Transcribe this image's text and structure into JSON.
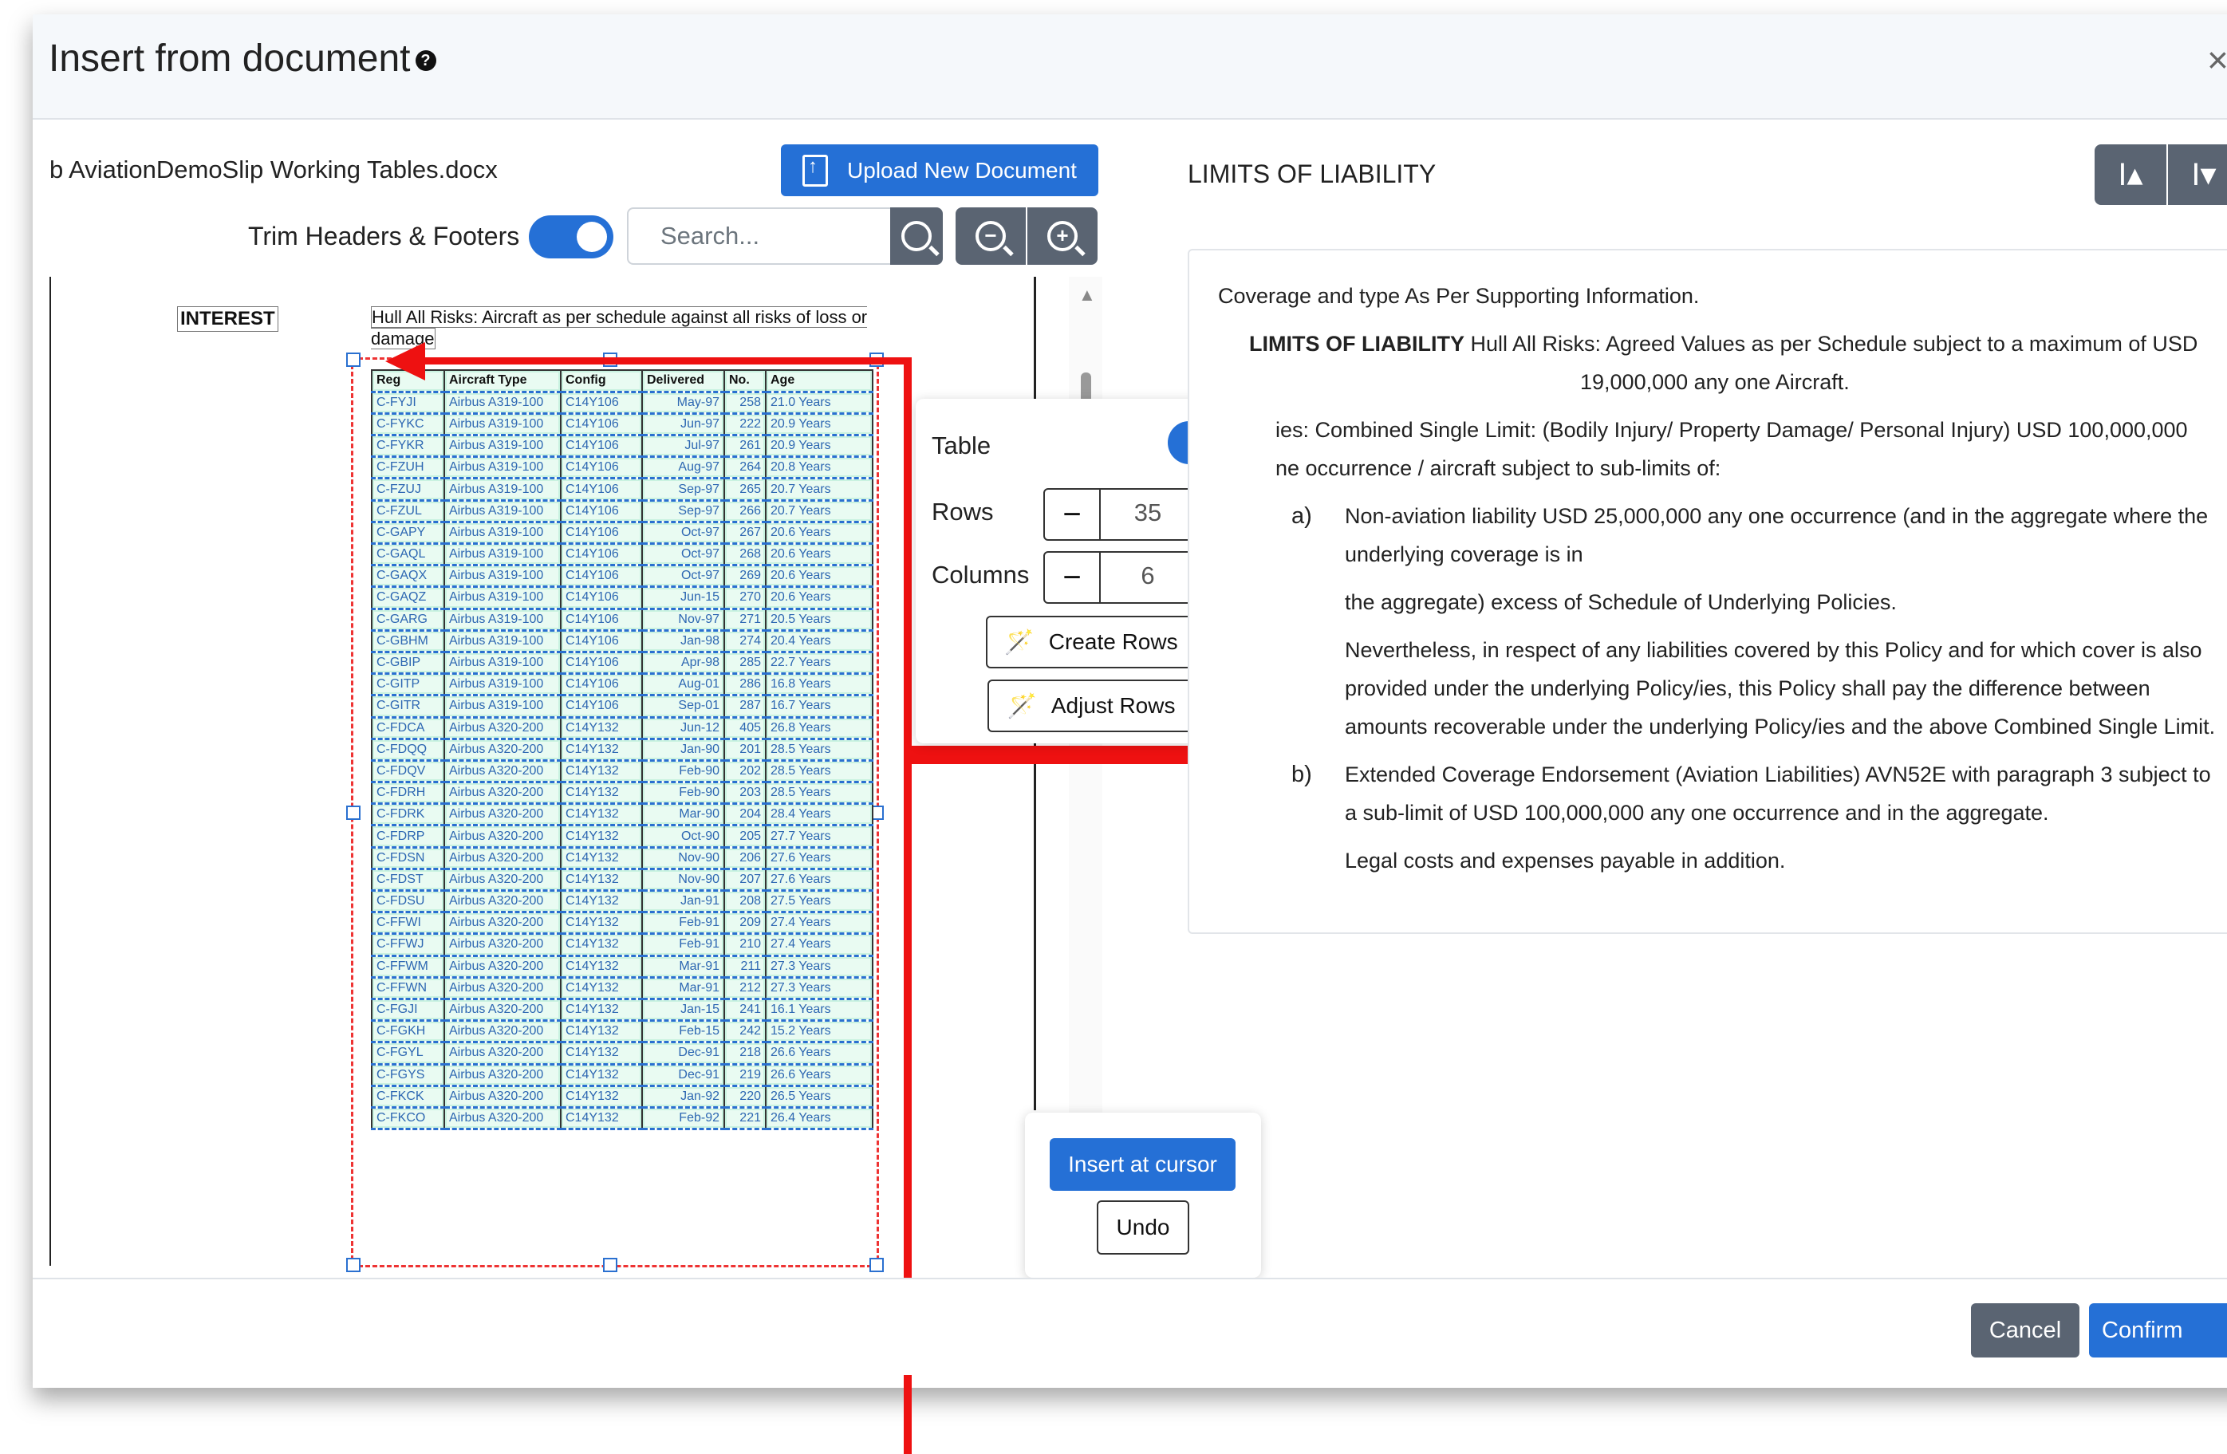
{
  "modal": {
    "title": "Insert from document",
    "close_label": "×"
  },
  "left": {
    "doc_name": "b AviationDemoSlip Working Tables.docx",
    "upload_label": "Upload New Document",
    "trim_label": "Trim Headers & Footers",
    "trim_enabled": true,
    "search_placeholder": "Search..."
  },
  "document": {
    "interest_label": "INTEREST",
    "interest_text": "Hull All Risks: Aircraft as per schedule against all risks of loss or damage",
    "table": {
      "headers": [
        "Reg",
        "Aircraft Type",
        "Config",
        "Delivered",
        "No.",
        "Age"
      ],
      "rows": [
        [
          "C-FYJI",
          "Airbus A319-100",
          "C14Y106",
          "May-97",
          "258",
          "21.0 Years"
        ],
        [
          "C-FYKC",
          "Airbus A319-100",
          "C14Y106",
          "Jun-97",
          "222",
          "20.9 Years"
        ],
        [
          "C-FYKR",
          "Airbus A319-100",
          "C14Y106",
          "Jul-97",
          "261",
          "20.9 Years"
        ],
        [
          "C-FZUH",
          "Airbus A319-100",
          "C14Y106",
          "Aug-97",
          "264",
          "20.8 Years"
        ],
        [
          "C-FZUJ",
          "Airbus A319-100",
          "C14Y106",
          "Sep-97",
          "265",
          "20.7 Years"
        ],
        [
          "C-FZUL",
          "Airbus A319-100",
          "C14Y106",
          "Sep-97",
          "266",
          "20.7 Years"
        ],
        [
          "C-GAPY",
          "Airbus A319-100",
          "C14Y106",
          "Oct-97",
          "267",
          "20.6 Years"
        ],
        [
          "C-GAQL",
          "Airbus A319-100",
          "C14Y106",
          "Oct-97",
          "268",
          "20.6 Years"
        ],
        [
          "C-GAQX",
          "Airbus A319-100",
          "C14Y106",
          "Oct-97",
          "269",
          "20.6 Years"
        ],
        [
          "C-GAQZ",
          "Airbus A319-100",
          "C14Y106",
          "Jun-15",
          "270",
          "20.6 Years"
        ],
        [
          "C-GARG",
          "Airbus A319-100",
          "C14Y106",
          "Nov-97",
          "271",
          "20.5 Years"
        ],
        [
          "C-GBHM",
          "Airbus A319-100",
          "C14Y106",
          "Jan-98",
          "274",
          "20.4 Years"
        ],
        [
          "C-GBIP",
          "Airbus A319-100",
          "C14Y106",
          "Apr-98",
          "285",
          "22.7 Years"
        ],
        [
          "C-GITP",
          "Airbus A319-100",
          "C14Y106",
          "Aug-01",
          "286",
          "16.8 Years"
        ],
        [
          "C-GITR",
          "Airbus A319-100",
          "C14Y106",
          "Sep-01",
          "287",
          "16.7 Years"
        ],
        [
          "C-FDCA",
          "Airbus A320-200",
          "C14Y132",
          "Jun-12",
          "405",
          "26.8 Years"
        ],
        [
          "C-FDQQ",
          "Airbus A320-200",
          "C14Y132",
          "Jan-90",
          "201",
          "28.5 Years"
        ],
        [
          "C-FDQV",
          "Airbus A320-200",
          "C14Y132",
          "Feb-90",
          "202",
          "28.5 Years"
        ],
        [
          "C-FDRH",
          "Airbus A320-200",
          "C14Y132",
          "Feb-90",
          "203",
          "28.5 Years"
        ],
        [
          "C-FDRK",
          "Airbus A320-200",
          "C14Y132",
          "Mar-90",
          "204",
          "28.4 Years"
        ],
        [
          "C-FDRP",
          "Airbus A320-200",
          "C14Y132",
          "Oct-90",
          "205",
          "27.7 Years"
        ],
        [
          "C-FDSN",
          "Airbus A320-200",
          "C14Y132",
          "Nov-90",
          "206",
          "27.6 Years"
        ],
        [
          "C-FDST",
          "Airbus A320-200",
          "C14Y132",
          "Nov-90",
          "207",
          "27.6 Years"
        ],
        [
          "C-FDSU",
          "Airbus A320-200",
          "C14Y132",
          "Jan-91",
          "208",
          "27.5 Years"
        ],
        [
          "C-FFWI",
          "Airbus A320-200",
          "C14Y132",
          "Feb-91",
          "209",
          "27.4 Years"
        ],
        [
          "C-FFWJ",
          "Airbus A320-200",
          "C14Y132",
          "Feb-91",
          "210",
          "27.4 Years"
        ],
        [
          "C-FFWM",
          "Airbus A320-200",
          "C14Y132",
          "Mar-91",
          "211",
          "27.3 Years"
        ],
        [
          "C-FFWN",
          "Airbus A320-200",
          "C14Y132",
          "Mar-91",
          "212",
          "27.3 Years"
        ],
        [
          "C-FGJI",
          "Airbus A320-200",
          "C14Y132",
          "Jan-15",
          "241",
          "16.1 Years"
        ],
        [
          "C-FGKH",
          "Airbus A320-200",
          "C14Y132",
          "Feb-15",
          "242",
          "15.2 Years"
        ],
        [
          "C-FGYL",
          "Airbus A320-200",
          "C14Y132",
          "Dec-91",
          "218",
          "26.6 Years"
        ],
        [
          "C-FGYS",
          "Airbus A320-200",
          "C14Y132",
          "Dec-91",
          "219",
          "26.6 Years"
        ],
        [
          "C-FKCK",
          "Airbus A320-200",
          "C14Y132",
          "Jan-92",
          "220",
          "26.5 Years"
        ],
        [
          "C-FKCO",
          "Airbus A320-200",
          "C14Y132",
          "Feb-92",
          "221",
          "26.4 Years"
        ]
      ]
    }
  },
  "table_panel": {
    "table_label": "Table",
    "table_enabled": true,
    "rows_label": "Rows",
    "rows_value": "35",
    "columns_label": "Columns",
    "columns_value": "6",
    "minus": "−",
    "plus": "+",
    "create_rows_label": "Create Rows",
    "adjust_rows_label": "Adjust Rows"
  },
  "insert_panel": {
    "insert_label": "Insert at cursor",
    "undo_label": "Undo"
  },
  "right": {
    "heading": "LIMITS OF LIABILITY",
    "preview": {
      "p1": "Coverage and type As Per Supporting Information.",
      "p2_bold": "LIMITS OF LIABILITY",
      "p2_rest": " Hull All Risks: Agreed Values as per Schedule subject to a maximum of USD",
      "p2_line2": "19,000,000 any one Aircraft.",
      "p3_line1": "ies: Combined Single Limit: (Bodily Injury/ Property Damage/ Personal Injury) USD 100,000,000",
      "p3_line2": "ne occurrence / aircraft subject to sub-limits of:",
      "a_marker": "a)",
      "a_line1": "Non-aviation liability USD 25,000,000 any one occurrence (and in the aggregate where the",
      "a_line2": "underlying coverage is in",
      "a_line3": "the aggregate) excess of Schedule of Underlying Policies.",
      "a_line4": "Nevertheless, in respect of any liabilities covered by this Policy and for which cover is also",
      "a_line5": "provided under the underlying Policy/ies, this Policy shall pay the difference between",
      "a_line6": "amounts recoverable under the underlying Policy/ies and the above Combined Single Limit.",
      "b_marker": "b)",
      "b_line1": "Extended Coverage Endorsement (Aviation Liabilities) AVN52E with paragraph 3 subject to",
      "b_line2": "a sub-limit of USD 100,000,000 any one occurrence and in the aggregate.",
      "b_line3": "Legal costs and expenses payable in addition."
    }
  },
  "footer": {
    "cancel_label": "Cancel",
    "confirm_label": "Confirm"
  },
  "colors": {
    "primary": "#2570d6",
    "secondary": "#5a6472",
    "annotation_red": "#ee1111"
  }
}
